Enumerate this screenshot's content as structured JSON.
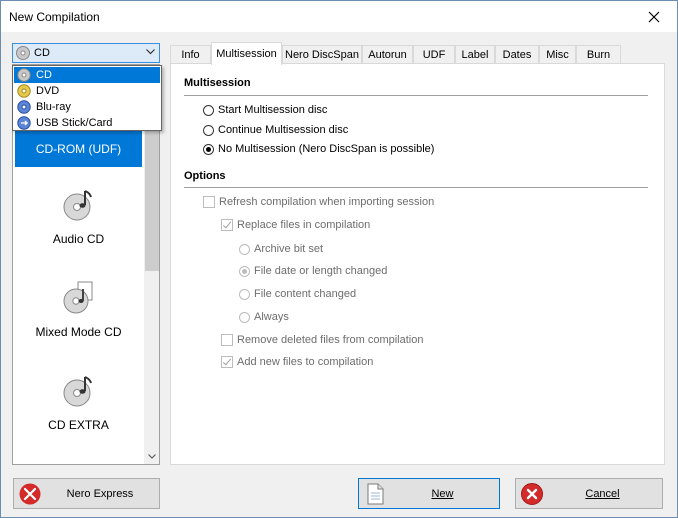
{
  "window": {
    "title": "New Compilation"
  },
  "type_select": {
    "value": "CD"
  },
  "dropdown_options": [
    {
      "label": "CD",
      "icon": "cd-icon",
      "selected": true
    },
    {
      "label": "DVD",
      "icon": "dvd-icon"
    },
    {
      "label": "Blu-ray",
      "icon": "bluray-icon"
    },
    {
      "label": "USB Stick/Card",
      "icon": "usb-icon"
    }
  ],
  "compilation_list": {
    "selected": "CD-ROM (UDF)",
    "items": [
      {
        "label": "Audio CD"
      },
      {
        "label": "Mixed Mode CD"
      },
      {
        "label": "CD EXTRA"
      }
    ]
  },
  "tabs": [
    {
      "label": "Info"
    },
    {
      "label": "Multisession",
      "active": true
    },
    {
      "label": "Nero DiscSpan"
    },
    {
      "label": "Autorun"
    },
    {
      "label": "UDF"
    },
    {
      "label": "Label"
    },
    {
      "label": "Dates"
    },
    {
      "label": "Misc"
    },
    {
      "label": "Burn"
    }
  ],
  "multisession": {
    "title": "Multisession",
    "options": [
      {
        "label": "Start Multisession disc",
        "checked": false
      },
      {
        "label": "Continue Multisession disc",
        "checked": false
      },
      {
        "label": "No Multisession (Nero DiscSpan is possible)",
        "checked": true
      }
    ]
  },
  "options": {
    "title": "Options",
    "refresh": {
      "label": "Refresh compilation when importing session",
      "checked": false
    },
    "replace": {
      "label": "Replace files in compilation",
      "checked": true
    },
    "replace_modes": [
      {
        "label": "Archive bit set",
        "checked": false
      },
      {
        "label": "File date or length changed",
        "checked": true
      },
      {
        "label": "File content changed",
        "checked": false
      },
      {
        "label": "Always",
        "checked": false
      }
    ],
    "remove_deleted": {
      "label": "Remove deleted files from compilation",
      "checked": false
    },
    "add_new": {
      "label": "Add new files to compilation",
      "checked": true
    }
  },
  "buttons": {
    "nero_express": "Nero Express",
    "new": "New",
    "cancel": "Cancel"
  },
  "colors": {
    "selection": "#0078d7",
    "title_bg": "#ffffff",
    "dialog_bg": "#f0f0f0"
  }
}
